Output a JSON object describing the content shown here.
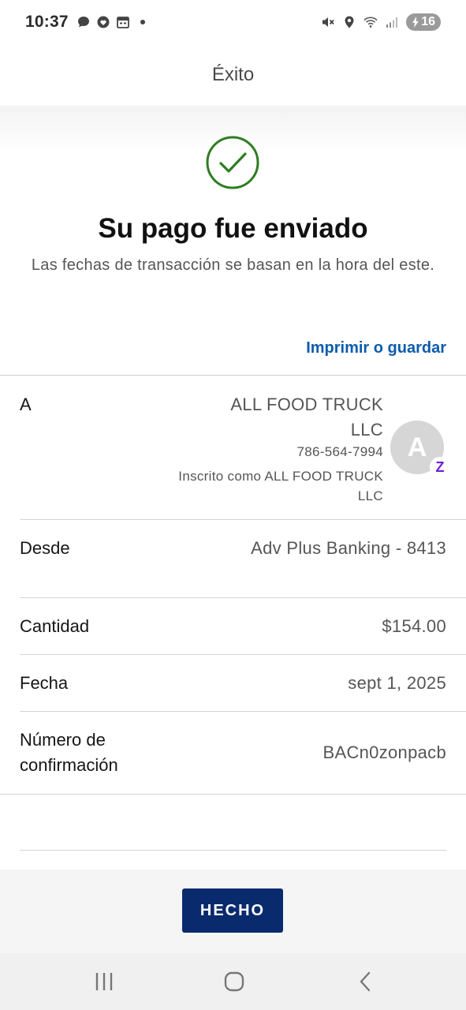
{
  "status_bar": {
    "time": "10:37",
    "battery_level": "16",
    "left_icons": [
      "chat-icon",
      "heart-chat-icon",
      "calendar-icon",
      "dot-icon"
    ],
    "right_icons": [
      "mute-icon",
      "location-icon",
      "wifi-icon",
      "signal-icon",
      "battery-icon"
    ]
  },
  "header": {
    "title": "Éxito"
  },
  "success": {
    "icon": "checkmark-circle-icon",
    "title": "Su pago fue enviado",
    "subtitle": "Las fechas de transacción se basan en la hora del este.",
    "print_link": "Imprimir o guardar",
    "accent_color": "#2e7d22",
    "link_color": "#0b5cad"
  },
  "details": {
    "to": {
      "label": "A",
      "name": "ALL FOOD TRUCK LLC",
      "phone": "786-564-7994",
      "enrolled": "Inscrito como ALL FOOD TRUCK LLC",
      "avatar_letter": "A",
      "badge": "Z"
    },
    "from": {
      "label": "Desde",
      "value": "Adv Plus Banking - 8413"
    },
    "amount": {
      "label": "Cantidad",
      "value": "$154.00"
    },
    "date": {
      "label": "Fecha",
      "value": "sept 1, 2025"
    },
    "confirmation": {
      "label": "Número de confirmación",
      "value": "BACn0zonpacb"
    }
  },
  "footer": {
    "done_label": "HECHO",
    "button_color": "#0a2a6e"
  },
  "nav_bar": {
    "items": [
      "recent-apps-icon",
      "home-icon",
      "back-icon"
    ]
  }
}
